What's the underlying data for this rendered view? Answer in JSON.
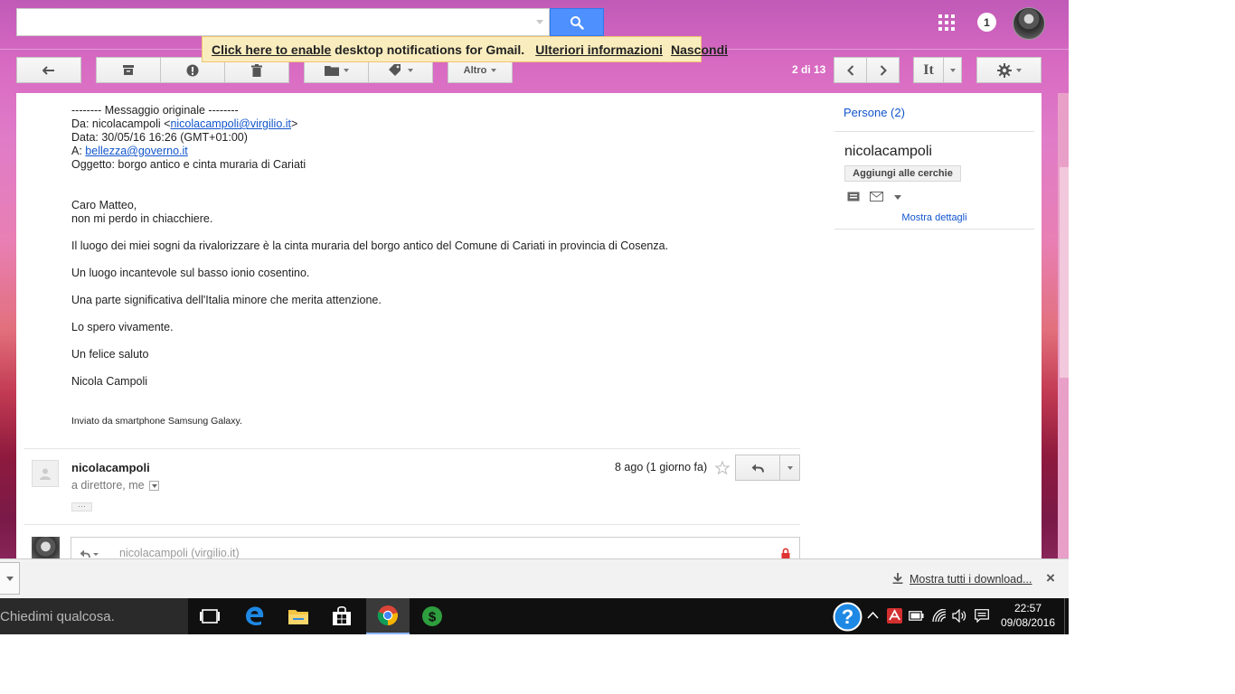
{
  "search": {
    "placeholder": ""
  },
  "header": {
    "notification_count": "1"
  },
  "notice": {
    "enable_link": "Click here to enable",
    "text": " desktop notifications for Gmail.",
    "more_info": "Ulteriori informazioni",
    "hide": "Nascondi"
  },
  "toolbar": {
    "altro_label": "Altro",
    "pager": "2 di 13",
    "lang_label": "It"
  },
  "message": {
    "orig_header": "-------- Messaggio originale --------",
    "da_label": "Da: nicolacampoli <",
    "da_email": "nicolacampoli@virgilio.it",
    "da_suffix": ">",
    "data_line": "Data: 30/05/16 16:26 (GMT+01:00)",
    "a_label": "A: ",
    "a_email": "bellezza@governo.it",
    "oggetto": "Oggetto: borgo antico e cinta muraria di Cariati",
    "greeting1": "Caro Matteo,",
    "greeting2": "non mi perdo in chiacchiere.",
    "p1": "Il luogo dei miei sogni da rivalorizzare è la cinta muraria del borgo antico del Comune di Cariati in provincia di Cosenza.",
    "p2": "Un luogo incantevole sul basso ionio cosentino.",
    "p3": "Una parte significativa dell'Italia minore che merita attenzione.",
    "p4": "Lo spero vivamente.",
    "p5": "Un felice saluto",
    "p6": "Nicola Campoli",
    "signature": "Inviato da smartphone Samsung Galaxy."
  },
  "second_message": {
    "sender": "nicolacampoli",
    "date": "8 ago (1 giorno fa)",
    "recipients": "a direttore, me",
    "ellipsis": "···"
  },
  "reply": {
    "placeholder": "nicolacampoli (virgilio.it)"
  },
  "people": {
    "title": "Persone (2)",
    "name": "nicolacampoli",
    "add_button": "Aggiungi alle cerchie",
    "details_link": "Mostra dettagli"
  },
  "downloads": {
    "show_all": "Mostra tutti i download...",
    "close": "×"
  },
  "taskbar": {
    "search_placeholder": "Chiedimi qualcosa.",
    "time": "22:57",
    "date": "09/08/2016"
  },
  "colors": {
    "gmail_blue": "#4d90fe",
    "link": "#1155cc",
    "notice_bg": "#f9edbe"
  }
}
